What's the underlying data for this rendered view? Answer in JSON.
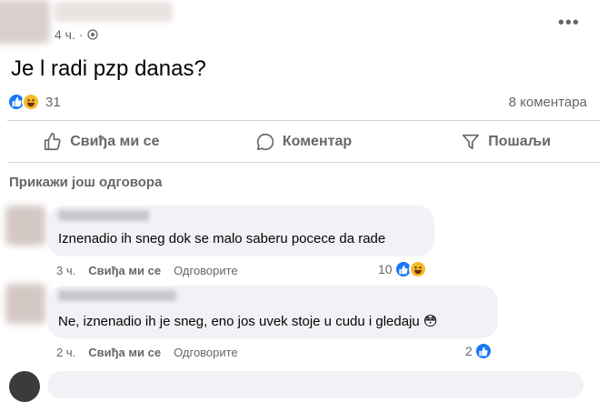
{
  "post": {
    "time": "4 ч.",
    "separator": "·",
    "text": "Je l radi pzp danas?",
    "more_label": "•••",
    "reaction_count": "31",
    "comments_count": "8 коментара"
  },
  "actions": {
    "like": "Свиђа ми се",
    "comment": "Коментар",
    "share": "Пошаљи"
  },
  "show_more_replies": "Прикажи још одговора",
  "comments": [
    {
      "text": "Iznenadio ih sneg dok se malo saberu pocece da rade",
      "time": "3 ч.",
      "like": "Свиђа ми се",
      "reply": "Одговорите",
      "reaction_count": "10"
    },
    {
      "text": "Ne, iznenadio ih je sneg, eno jos uvek stoje u cudu i gledaju 😳",
      "time": "2 ч.",
      "like": "Свиђа ми се",
      "reply": "Одговорите",
      "reaction_count": "2"
    }
  ],
  "colors": {
    "accent": "#1877f2",
    "haha": "#f7b928",
    "secondary_text": "#65676b",
    "bubble": "#f0f2f5"
  },
  "icons": [
    "globe-icon",
    "more-icon",
    "like-icon",
    "haha-icon",
    "thumbs-up-icon",
    "comment-icon",
    "share-icon"
  ]
}
